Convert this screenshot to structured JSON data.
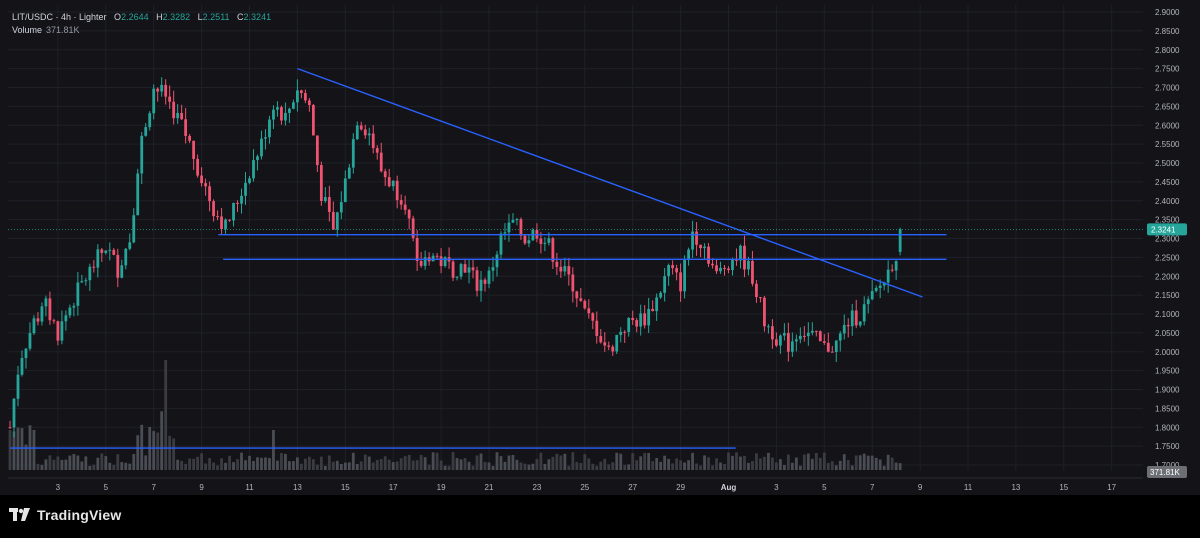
{
  "header": {
    "symbol_line": "LIT/USDC · 4h · Lighter",
    "open_label": "O",
    "open_value": "2.2644",
    "high_label": "H",
    "high_value": "2.3282",
    "low_label": "L",
    "low_value": "2.2511",
    "close_label": "C",
    "close_value": "2.3241",
    "volume_label": "Volume",
    "volume_value": "371.81K"
  },
  "price_axis": {
    "ticks": [
      "2.9000",
      "2.8500",
      "2.8000",
      "2.7500",
      "2.7000",
      "2.6500",
      "2.6000",
      "2.5500",
      "2.5000",
      "2.4500",
      "2.4000",
      "2.3500",
      "2.3000",
      "2.2500",
      "2.2000",
      "2.1500",
      "2.1000",
      "2.0500",
      "2.0000",
      "1.9500",
      "1.9000",
      "1.8500",
      "1.8000",
      "1.7500",
      "1.7000"
    ],
    "last_price_label": "2.3241",
    "volume_label": "371.81K"
  },
  "time_axis": {
    "ticks": [
      {
        "label": "3",
        "bold": false
      },
      {
        "label": "5",
        "bold": false
      },
      {
        "label": "7",
        "bold": false
      },
      {
        "label": "9",
        "bold": false
      },
      {
        "label": "11",
        "bold": false
      },
      {
        "label": "13",
        "bold": false
      },
      {
        "label": "15",
        "bold": false
      },
      {
        "label": "17",
        "bold": false
      },
      {
        "label": "19",
        "bold": false
      },
      {
        "label": "21",
        "bold": false
      },
      {
        "label": "23",
        "bold": false
      },
      {
        "label": "25",
        "bold": false
      },
      {
        "label": "27",
        "bold": false
      },
      {
        "label": "29",
        "bold": false
      },
      {
        "label": "Aug",
        "bold": true
      },
      {
        "label": "3",
        "bold": false
      },
      {
        "label": "5",
        "bold": false
      },
      {
        "label": "7",
        "bold": false
      },
      {
        "label": "9",
        "bold": false
      },
      {
        "label": "11",
        "bold": false
      },
      {
        "label": "13",
        "bold": false
      },
      {
        "label": "15",
        "bold": false
      },
      {
        "label": "17",
        "bold": false
      }
    ]
  },
  "chart_data": {
    "type": "candlestick",
    "pair": "LIT/USDC",
    "interval": "4h",
    "exchange": "Lighter",
    "ylim": [
      1.7,
      2.9
    ],
    "up_color": "#26a69a",
    "down_color": "#ef5370",
    "line_color": "#2962ff",
    "price_path": [
      {
        "t": 0.0,
        "p": 1.8
      },
      {
        "t": 0.4,
        "p": 1.98
      },
      {
        "t": 1.0,
        "p": 2.08
      },
      {
        "t": 1.5,
        "p": 2.12
      },
      {
        "t": 2.0,
        "p": 2.05
      },
      {
        "t": 2.5,
        "p": 2.12
      },
      {
        "t": 3.0,
        "p": 2.18
      },
      {
        "t": 3.5,
        "p": 2.23
      },
      {
        "t": 4.0,
        "p": 2.28
      },
      {
        "t": 4.5,
        "p": 2.22
      },
      {
        "t": 5.0,
        "p": 2.3
      },
      {
        "t": 5.5,
        "p": 2.56
      },
      {
        "t": 6.0,
        "p": 2.7
      },
      {
        "t": 6.5,
        "p": 2.68
      },
      {
        "t": 7.0,
        "p": 2.62
      },
      {
        "t": 7.5,
        "p": 2.55
      },
      {
        "t": 8.0,
        "p": 2.46
      },
      {
        "t": 8.5,
        "p": 2.38
      },
      {
        "t": 9.0,
        "p": 2.33
      },
      {
        "t": 9.5,
        "p": 2.4
      },
      {
        "t": 10.0,
        "p": 2.48
      },
      {
        "t": 10.5,
        "p": 2.55
      },
      {
        "t": 11.0,
        "p": 2.66
      },
      {
        "t": 11.5,
        "p": 2.62
      },
      {
        "t": 12.0,
        "p": 2.7
      },
      {
        "t": 12.5,
        "p": 2.65
      },
      {
        "t": 13.0,
        "p": 2.42
      },
      {
        "t": 13.5,
        "p": 2.32
      },
      {
        "t": 14.0,
        "p": 2.45
      },
      {
        "t": 14.5,
        "p": 2.62
      },
      {
        "t": 15.0,
        "p": 2.58
      },
      {
        "t": 15.5,
        "p": 2.48
      },
      {
        "t": 16.0,
        "p": 2.44
      },
      {
        "t": 16.5,
        "p": 2.4
      },
      {
        "t": 17.0,
        "p": 2.22
      },
      {
        "t": 17.5,
        "p": 2.26
      },
      {
        "t": 18.0,
        "p": 2.24
      },
      {
        "t": 18.5,
        "p": 2.22
      },
      {
        "t": 19.0,
        "p": 2.23
      },
      {
        "t": 19.5,
        "p": 2.18
      },
      {
        "t": 20.0,
        "p": 2.2
      },
      {
        "t": 20.5,
        "p": 2.3
      },
      {
        "t": 21.0,
        "p": 2.34
      },
      {
        "t": 21.5,
        "p": 2.3
      },
      {
        "t": 22.0,
        "p": 2.32
      },
      {
        "t": 22.5,
        "p": 2.28
      },
      {
        "t": 23.0,
        "p": 2.22
      },
      {
        "t": 23.5,
        "p": 2.18
      },
      {
        "t": 24.0,
        "p": 2.1
      },
      {
        "t": 24.5,
        "p": 2.06
      },
      {
        "t": 25.0,
        "p": 2.0
      },
      {
        "t": 25.5,
        "p": 2.06
      },
      {
        "t": 26.0,
        "p": 2.08
      },
      {
        "t": 26.5,
        "p": 2.09
      },
      {
        "t": 27.0,
        "p": 2.14
      },
      {
        "t": 27.5,
        "p": 2.22
      },
      {
        "t": 28.0,
        "p": 2.18
      },
      {
        "t": 28.5,
        "p": 2.32
      },
      {
        "t": 29.0,
        "p": 2.28
      },
      {
        "t": 29.5,
        "p": 2.2
      },
      {
        "t": 30.0,
        "p": 2.24
      },
      {
        "t": 30.5,
        "p": 2.26
      },
      {
        "t": 31.0,
        "p": 2.2
      },
      {
        "t": 31.5,
        "p": 2.08
      },
      {
        "t": 32.0,
        "p": 2.04
      },
      {
        "t": 32.5,
        "p": 2.02
      },
      {
        "t": 33.0,
        "p": 2.06
      },
      {
        "t": 33.5,
        "p": 2.04
      },
      {
        "t": 34.0,
        "p": 2.01
      },
      {
        "t": 34.5,
        "p": 2.02
      },
      {
        "t": 35.0,
        "p": 2.08
      },
      {
        "t": 35.5,
        "p": 2.1
      },
      {
        "t": 36.0,
        "p": 2.14
      },
      {
        "t": 36.5,
        "p": 2.19
      },
      {
        "t": 37.0,
        "p": 2.26
      },
      {
        "t": 37.3,
        "p": 2.32
      }
    ],
    "trendlines": [
      {
        "name": "descending-trendline",
        "t1": 12.0,
        "p1": 2.75,
        "t2": 38.1,
        "p2": 2.145
      },
      {
        "name": "resistance-line",
        "t1": 8.7,
        "p1": 2.31,
        "t2": 39.1,
        "p2": 2.31
      },
      {
        "name": "support-line",
        "t1": 8.9,
        "p1": 2.245,
        "t2": 39.1,
        "p2": 2.245
      },
      {
        "name": "volume-baseline",
        "t1": 0.0,
        "p1": 1.745,
        "t2": 30.3,
        "p2": 1.745
      }
    ]
  },
  "footer": {
    "brand": "TradingView"
  }
}
